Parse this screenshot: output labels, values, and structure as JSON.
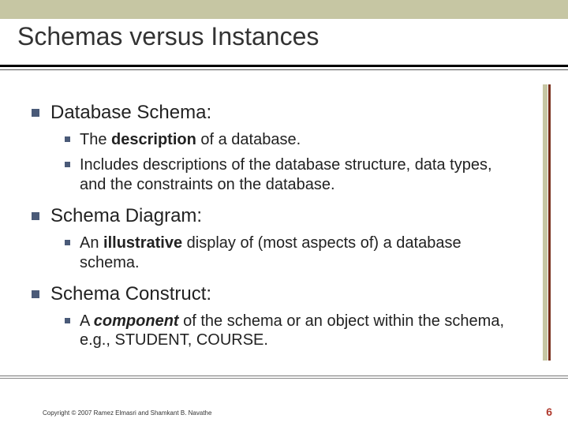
{
  "title": "Schemas versus Instances",
  "items": [
    {
      "label": "Database Schema:",
      "subs": [
        {
          "pre": "The ",
          "strong": "description",
          "post": " of a database."
        },
        {
          "pre": "Includes descriptions of the database structure, data types, and the constraints on the database.",
          "strong": "",
          "post": ""
        }
      ]
    },
    {
      "label": "Schema Diagram:",
      "subs": [
        {
          "pre": "An ",
          "strong": "illustrative",
          "post": " display of (most aspects of) a database schema."
        }
      ]
    },
    {
      "label": "Schema Construct:",
      "subs": [
        {
          "pre": "A ",
          "strong": "component",
          "post": " of the schema or an object within the schema, e.g., STUDENT, COURSE."
        }
      ]
    }
  ],
  "copyright": "Copyright © 2007 Ramez Elmasri and Shamkant B. Navathe",
  "page_number": "6"
}
